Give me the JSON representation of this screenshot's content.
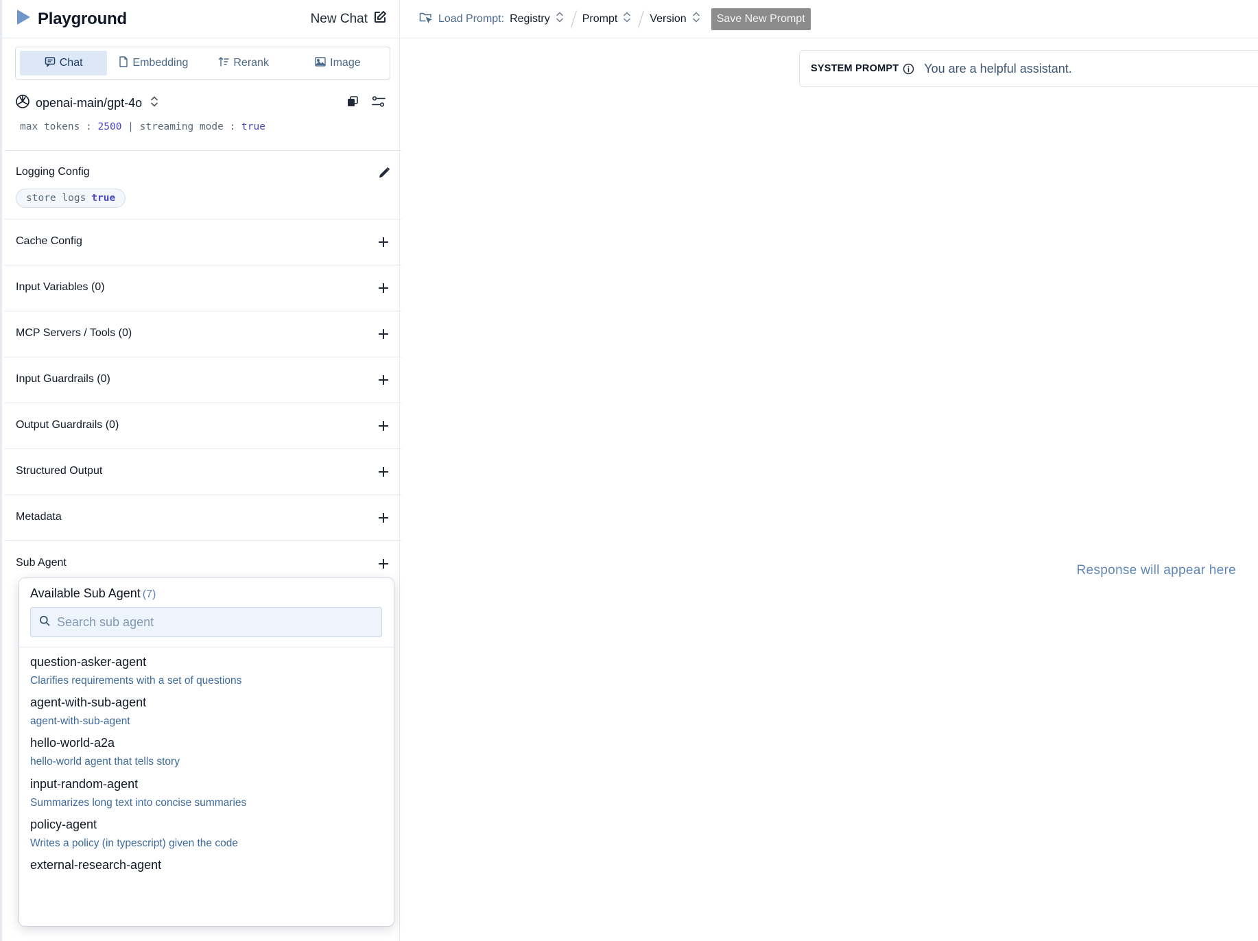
{
  "app": {
    "title": "Playground",
    "new_chat_label": "New Chat"
  },
  "tabs": [
    {
      "label": "Chat",
      "icon": "chat-bubble-icon",
      "active": true
    },
    {
      "label": "Embedding",
      "icon": "document-icon",
      "active": false
    },
    {
      "label": "Rerank",
      "icon": "sort-icon",
      "active": false
    },
    {
      "label": "Image",
      "icon": "image-icon",
      "active": false
    }
  ],
  "model": {
    "name": "openai-main/gpt-4o",
    "max_tokens_label": "max tokens :",
    "max_tokens_value": "2500",
    "separator": "|",
    "streaming_label": "streaming mode :",
    "streaming_value": "true"
  },
  "logging": {
    "title": "Logging Config",
    "chip_label": "store logs",
    "chip_value": "true"
  },
  "sections": [
    {
      "title": "Cache Config"
    },
    {
      "title": "Input Variables (0)"
    },
    {
      "title": "MCP Servers / Tools (0)"
    },
    {
      "title": "Input Guardrails (0)"
    },
    {
      "title": "Output Guardrails (0)"
    },
    {
      "title": "Structured Output"
    },
    {
      "title": "Metadata"
    },
    {
      "title": "Sub Agent"
    }
  ],
  "sub_agent_dropdown": {
    "title": "Available Sub Agent",
    "count": "(7)",
    "search_placeholder": "Search sub agent",
    "items": [
      {
        "name": "question-asker-agent",
        "description": "Clarifies requirements with a set of questions"
      },
      {
        "name": "agent-with-sub-agent",
        "description": "agent-with-sub-agent"
      },
      {
        "name": "hello-world-a2a",
        "description": "hello-world agent that tells story"
      },
      {
        "name": "input-random-agent",
        "description": "Summarizes long text into concise summaries"
      },
      {
        "name": "policy-agent",
        "description": "Writes a policy (in typescript) given the code"
      },
      {
        "name": "external-research-agent",
        "description": ""
      }
    ]
  },
  "topbar": {
    "load_prompt_label": "Load Prompt:",
    "registry_label": "Registry",
    "prompt_label": "Prompt",
    "version_label": "Version",
    "save_button_label": "Save New Prompt"
  },
  "system_prompt": {
    "label": "SYSTEM PROMPT",
    "text": "You are a helpful assistant."
  },
  "response_placeholder": "Response will appear here",
  "colors": {
    "accent": "#4a48c9",
    "brand_icon": "#6f96c8",
    "link_blue": "#5f87b5",
    "active_tab_bg": "#dde8f6",
    "save_button_bg": "#8c8c8c"
  }
}
